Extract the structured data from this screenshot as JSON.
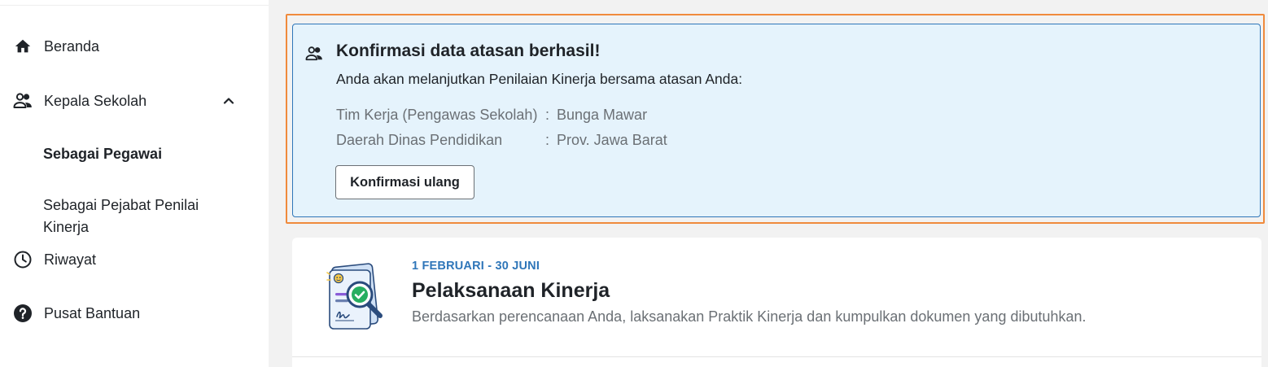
{
  "sidebar": {
    "items": [
      {
        "label": "Beranda",
        "icon": "home-icon"
      },
      {
        "label": "Kepala Sekolah",
        "icon": "people-icon",
        "expanded": true,
        "children": [
          {
            "label": "Sebagai Pegawai",
            "active": true
          },
          {
            "label": "Sebagai Pejabat Penilai Kinerja",
            "active": false
          }
        ]
      },
      {
        "label": "Riwayat",
        "icon": "clock-icon"
      },
      {
        "label": "Pusat Bantuan",
        "icon": "help-icon"
      }
    ]
  },
  "confirmation": {
    "icon": "people-icon",
    "title": "Konfirmasi data atasan berhasil!",
    "subtitle": "Anda akan melanjutkan Penilaian Kinerja bersama atasan Anda:",
    "details": [
      {
        "label": "Tim Kerja (Pengawas Sekolah)",
        "separator": ":",
        "value": "Bunga Mawar"
      },
      {
        "label": "Daerah Dinas Pendidikan",
        "separator": ":",
        "value": "Prov. Jawa Barat"
      }
    ],
    "button_label": "Konfirmasi ulang"
  },
  "phase": {
    "illustration": "document-check-icon",
    "date_range": "1 FEBRUARI - 30 JUNI",
    "title": "Pelaksanaan Kinerja",
    "description": "Berdasarkan perencanaan Anda, laksanakan Praktik Kinerja dan kumpulkan dokumen yang dibutuhkan."
  },
  "colors": {
    "accent_blue": "#2f76b9",
    "alert_background": "#e5f3fc",
    "highlight_orange": "#f08a3c",
    "main_background": "#f2f2f2",
    "text_primary": "#1f2328",
    "text_secondary": "#6b7075"
  }
}
